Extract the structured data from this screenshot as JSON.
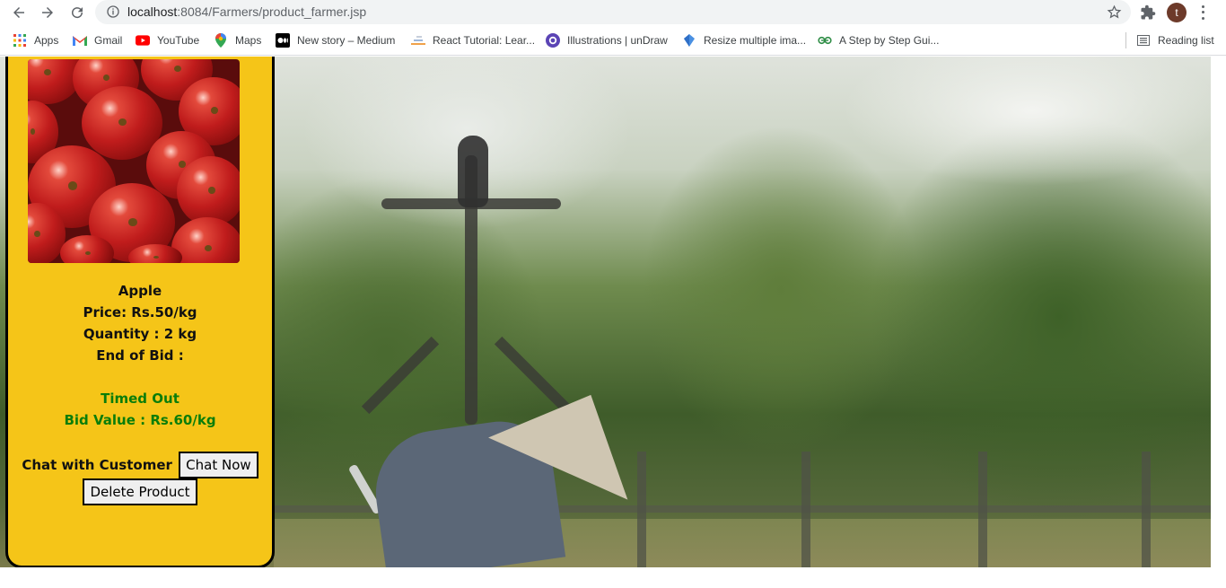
{
  "browser": {
    "url_host": "localhost",
    "url_rest": ":8084/Farmers/product_farmer.jsp",
    "profile_initial": "t",
    "bookmarks": [
      {
        "label": "Apps",
        "icon": "apps-grid-icon"
      },
      {
        "label": "Gmail",
        "icon": "gmail-icon"
      },
      {
        "label": "YouTube",
        "icon": "youtube-icon"
      },
      {
        "label": "Maps",
        "icon": "maps-icon"
      },
      {
        "label": "New story – Medium",
        "icon": "medium-icon"
      },
      {
        "label": "React Tutorial: Lear...",
        "icon": "react-tutorial-icon"
      },
      {
        "label": "Illustrations | unDraw",
        "icon": "undraw-icon"
      },
      {
        "label": "Resize multiple ima...",
        "icon": "resize-icon"
      },
      {
        "label": "A Step by Step Gui...",
        "icon": "geeksforgeeks-icon"
      }
    ],
    "reading_list": "Reading list"
  },
  "product": {
    "name": "Apple",
    "price": "Price: Rs.50/kg",
    "quantity": "Quantity : 2 kg",
    "end_of_bid": "End of Bid :",
    "status": "Timed Out",
    "bid_value": "Bid Value : Rs.60/kg",
    "chat_label": "Chat with Customer",
    "chat_button": "Chat Now",
    "delete_button": "Delete Product"
  },
  "colors": {
    "card_bg": "#f5c518",
    "status_green": "#0a7d0a"
  }
}
